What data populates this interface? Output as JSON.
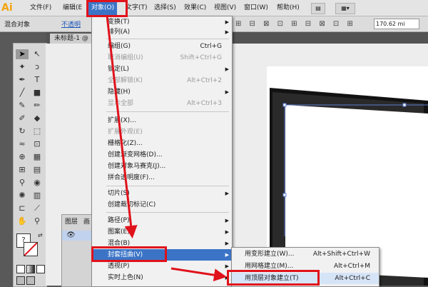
{
  "app": {
    "logo": "Ai",
    "menus": [
      {
        "label": "文件(F)"
      },
      {
        "label": "编辑(E"
      },
      {
        "label": "对象(O)"
      },
      {
        "label": "文字(T)"
      },
      {
        "label": "选择(S)"
      },
      {
        "label": "效果(C)"
      },
      {
        "label": "视图(V)"
      },
      {
        "label": "窗口(W)"
      },
      {
        "label": "帮助(H)"
      }
    ]
  },
  "control_bar": {
    "label": "混合对象",
    "link": "不透明",
    "size_value": "170.62 mi"
  },
  "document_tab": "未标题-1 @",
  "layers_panel": {
    "tab1": "图层",
    "tab2": "画"
  },
  "object_menu": {
    "items": [
      {
        "label": "变换(T)",
        "shortcut": "",
        "submenu": true,
        "disabled": false
      },
      {
        "label": "排列(A)",
        "shortcut": "",
        "submenu": true,
        "disabled": false
      },
      {
        "label": "编组(G)",
        "shortcut": "Ctrl+G",
        "submenu": false,
        "disabled": false
      },
      {
        "label": "取消编组(U)",
        "shortcut": "Shift+Ctrl+G",
        "submenu": false,
        "disabled": true
      },
      {
        "label": "锁定(L)",
        "shortcut": "",
        "submenu": true,
        "disabled": false
      },
      {
        "label": "全部解锁(K)",
        "shortcut": "Alt+Ctrl+2",
        "submenu": false,
        "disabled": true
      },
      {
        "label": "隐藏(H)",
        "shortcut": "",
        "submenu": true,
        "disabled": false
      },
      {
        "label": "显示全部",
        "shortcut": "Alt+Ctrl+3",
        "submenu": false,
        "disabled": true
      },
      {
        "label": "扩展(X)...",
        "shortcut": "",
        "submenu": false,
        "disabled": false
      },
      {
        "label": "扩展外观(E)",
        "shortcut": "",
        "submenu": false,
        "disabled": true
      },
      {
        "label": "栅格化(Z)...",
        "shortcut": "",
        "submenu": false,
        "disabled": false
      },
      {
        "label": "创建渐变网格(D)...",
        "shortcut": "",
        "submenu": false,
        "disabled": false
      },
      {
        "label": "创建对象马赛克(J)...",
        "shortcut": "",
        "submenu": false,
        "disabled": false
      },
      {
        "label": "拼合透明度(F)...",
        "shortcut": "",
        "submenu": false,
        "disabled": false
      },
      {
        "label": "切片(S)",
        "shortcut": "",
        "submenu": true,
        "disabled": false
      },
      {
        "label": "创建裁切标记(C)",
        "shortcut": "",
        "submenu": false,
        "disabled": false
      },
      {
        "label": "路径(P)",
        "shortcut": "",
        "submenu": true,
        "disabled": false
      },
      {
        "label": "图案(E)",
        "shortcut": "",
        "submenu": true,
        "disabled": false
      },
      {
        "label": "混合(B)",
        "shortcut": "",
        "submenu": true,
        "disabled": false
      },
      {
        "label": "封套扭曲(V)",
        "shortcut": "",
        "submenu": true,
        "disabled": false
      },
      {
        "label": "透视(P)",
        "shortcut": "",
        "submenu": true,
        "disabled": false
      },
      {
        "label": "实时上色(N)",
        "shortcut": "",
        "submenu": true,
        "disabled": false
      }
    ]
  },
  "envelope_submenu": {
    "items": [
      {
        "label": "用变形建立(W)...",
        "shortcut": "Alt+Shift+Ctrl+W"
      },
      {
        "label": "用网格建立(M)...",
        "shortcut": "Alt+Ctrl+M"
      },
      {
        "label": "用顶层对象建立(T)",
        "shortcut": "Alt+Ctrl+C"
      }
    ]
  },
  "colors": {
    "menu_highlight": "#3b74c7",
    "annotation_red": "#e0121b",
    "app_accent": "#f2a30f"
  }
}
